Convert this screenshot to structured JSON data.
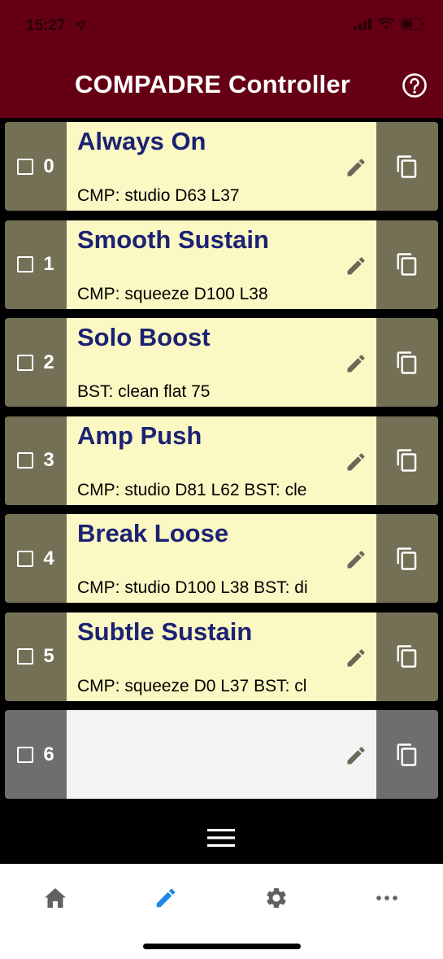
{
  "status_bar": {
    "time": "15:27"
  },
  "header": {
    "title": "COMPADRE Controller",
    "help_icon": "help-circle-icon"
  },
  "colors": {
    "header_bg": "#650014",
    "row_side_bg": "#737056",
    "row_main_bg": "#fcf8c3",
    "preset_name": "#1c2273",
    "empty_side_bg": "#6e6e6e",
    "empty_main_bg": "#f3f3f3",
    "active_tab": "#1e88e5",
    "inactive_tab": "#616161"
  },
  "presets": [
    {
      "number": "0",
      "name": "Always On",
      "desc": "CMP: studio D63 L37"
    },
    {
      "number": "1",
      "name": "Smooth Sustain",
      "desc": "CMP: squeeze D100 L38"
    },
    {
      "number": "2",
      "name": "Solo Boost",
      "desc": " BST: clean flat 75"
    },
    {
      "number": "3",
      "name": "Amp Push",
      "desc": "CMP: studio D81 L62 BST: cle"
    },
    {
      "number": "4",
      "name": "Break Loose",
      "desc": "CMP: studio D100 L38 BST: di"
    },
    {
      "number": "5",
      "name": "Subtle Sustain",
      "desc": "CMP: squeeze D0 L37 BST: cl"
    },
    {
      "number": "6",
      "name": "",
      "desc": ""
    }
  ],
  "tabs": [
    {
      "icon": "home-icon",
      "active": false
    },
    {
      "icon": "pencil-icon",
      "active": true
    },
    {
      "icon": "gear-icon",
      "active": false
    },
    {
      "icon": "more-dots-icon",
      "active": false
    }
  ]
}
